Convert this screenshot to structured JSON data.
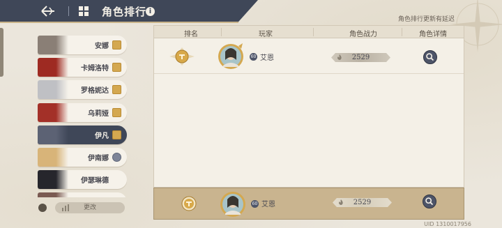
{
  "header": {
    "title": "角色排行",
    "notice": "角色排行更新有延迟"
  },
  "sidebar": {
    "items": [
      {
        "name": "安娜",
        "badge": "gold",
        "portrait_color": "#8a7f76"
      },
      {
        "name": "卡姆洛特",
        "badge": "gold",
        "portrait_color": "#9e2a22"
      },
      {
        "name": "罗格妮达",
        "badge": "gold",
        "portrait_color": "#bfc0c4"
      },
      {
        "name": "乌莉娅",
        "badge": "gold",
        "portrait_color": "#a33028"
      },
      {
        "name": "伊凡",
        "badge": "gold",
        "portrait_color": "#5c6274",
        "active": true
      },
      {
        "name": "伊南娜",
        "badge": "gray",
        "portrait_color": "#d8b479"
      },
      {
        "name": "伊瑟琳德",
        "badge": "none",
        "portrait_color": "#26262c"
      },
      {
        "name": "",
        "badge": "none",
        "portrait_color": "#7a5a52"
      }
    ],
    "change_label": "更改"
  },
  "table": {
    "headers": [
      "排名",
      "玩家",
      "角色战力",
      "角色详情"
    ],
    "rows": [
      {
        "player": "艾恩",
        "power": "2529",
        "level_icon": "lvl-icon"
      }
    ]
  },
  "self_row": {
    "player": "艾恩",
    "power": "2529"
  },
  "uid": "UID 1310017956"
}
